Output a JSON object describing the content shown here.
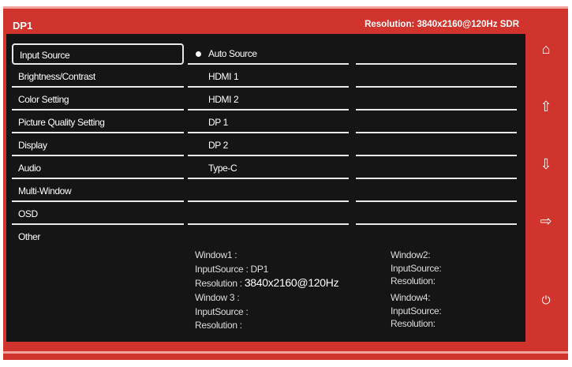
{
  "header": {
    "source": "DP1",
    "resolution": "Resolution: 3840x2160@120Hz  SDR"
  },
  "menu": [
    "Input Source",
    "Brightness/Contrast",
    "Color Setting",
    "Picture Quality Setting",
    "Display",
    "Audio",
    "Multi-Window",
    "OSD",
    "Other"
  ],
  "submenu": [
    "Auto Source",
    "HDMI 1",
    "HDMI 2",
    "DP 1",
    "DP 2",
    "Type-C"
  ],
  "windows": {
    "w1": [
      "Window1 :",
      "InputSource : DP1",
      "Resolution : "
    ],
    "w1_res": "3840x2160@120Hz",
    "w3": [
      "Window 3 :",
      "InputSource :",
      "Resolution :"
    ],
    "w2": [
      "Window2:",
      "InputSource:",
      "Resolution:"
    ],
    "w4": [
      "Window4:",
      "InputSource:",
      "Resolution:"
    ]
  },
  "side_icons": [
    "home-icon",
    "up-arrow-icon",
    "down-arrow-icon",
    "exit-icon",
    "power-icon"
  ]
}
